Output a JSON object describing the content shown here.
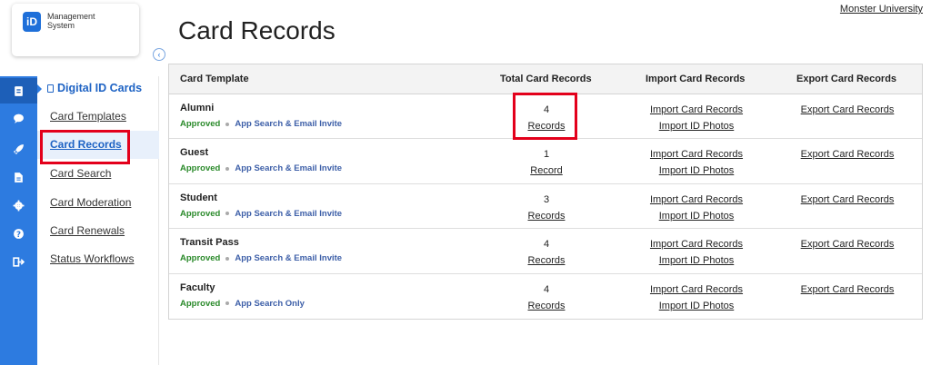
{
  "app": {
    "logo_badge": "iD",
    "logo_line1": "Management",
    "logo_line2": "System",
    "collapse_icon": "chevron-left-icon"
  },
  "org_link": "Monster University",
  "page_title": "Card Records",
  "rail": {
    "items": [
      {
        "icon": "id-card-icon",
        "active": true
      },
      {
        "icon": "chat-icon",
        "active": false
      },
      {
        "icon": "rocket-icon",
        "active": false
      },
      {
        "icon": "document-icon",
        "active": false
      },
      {
        "icon": "gear-icon",
        "active": false
      },
      {
        "icon": "help-icon",
        "active": false
      },
      {
        "icon": "sign-out-icon",
        "active": false
      }
    ]
  },
  "subnav": {
    "title": "Digital ID Cards",
    "items": [
      {
        "label": "Card Templates",
        "active": false
      },
      {
        "label": "Card Records",
        "active": true
      },
      {
        "label": "Card Search",
        "active": false
      },
      {
        "label": "Card Moderation",
        "active": false
      },
      {
        "label": "Card Renewals",
        "active": false
      },
      {
        "label": "Status Workflows",
        "active": false
      }
    ]
  },
  "table": {
    "headers": [
      "Card Template",
      "Total Card Records",
      "Import Card Records",
      "Export Card Records"
    ],
    "rows": [
      {
        "name": "Alumni",
        "status": "Approved",
        "scope": "App Search & Email Invite",
        "count": "4",
        "count_link": "Records",
        "import_records": "Import Card Records",
        "import_photos": "Import ID Photos",
        "export": "Export Card Records"
      },
      {
        "name": "Guest",
        "status": "Approved",
        "scope": "App Search & Email Invite",
        "count": "1",
        "count_link": "Record",
        "import_records": "Import Card Records",
        "import_photos": "Import ID Photos",
        "export": "Export Card Records"
      },
      {
        "name": "Student",
        "status": "Approved",
        "scope": "App Search & Email Invite",
        "count": "3",
        "count_link": "Records",
        "import_records": "Import Card Records",
        "import_photos": "Import ID Photos",
        "export": "Export Card Records"
      },
      {
        "name": "Transit Pass",
        "status": "Approved",
        "scope": "App Search & Email Invite",
        "count": "4",
        "count_link": "Records",
        "import_records": "Import Card Records",
        "import_photos": "Import ID Photos",
        "export": "Export Card Records"
      },
      {
        "name": "Faculty",
        "status": "Approved",
        "scope": "App Search Only",
        "count": "4",
        "count_link": "Records",
        "import_records": "Import Card Records",
        "import_photos": "Import ID Photos",
        "export": "Export Card Records"
      }
    ]
  },
  "colors": {
    "rail": "#2d7be0",
    "accent": "#1e63c4",
    "approved": "#2a8a2a",
    "highlight": "#e3001b"
  }
}
